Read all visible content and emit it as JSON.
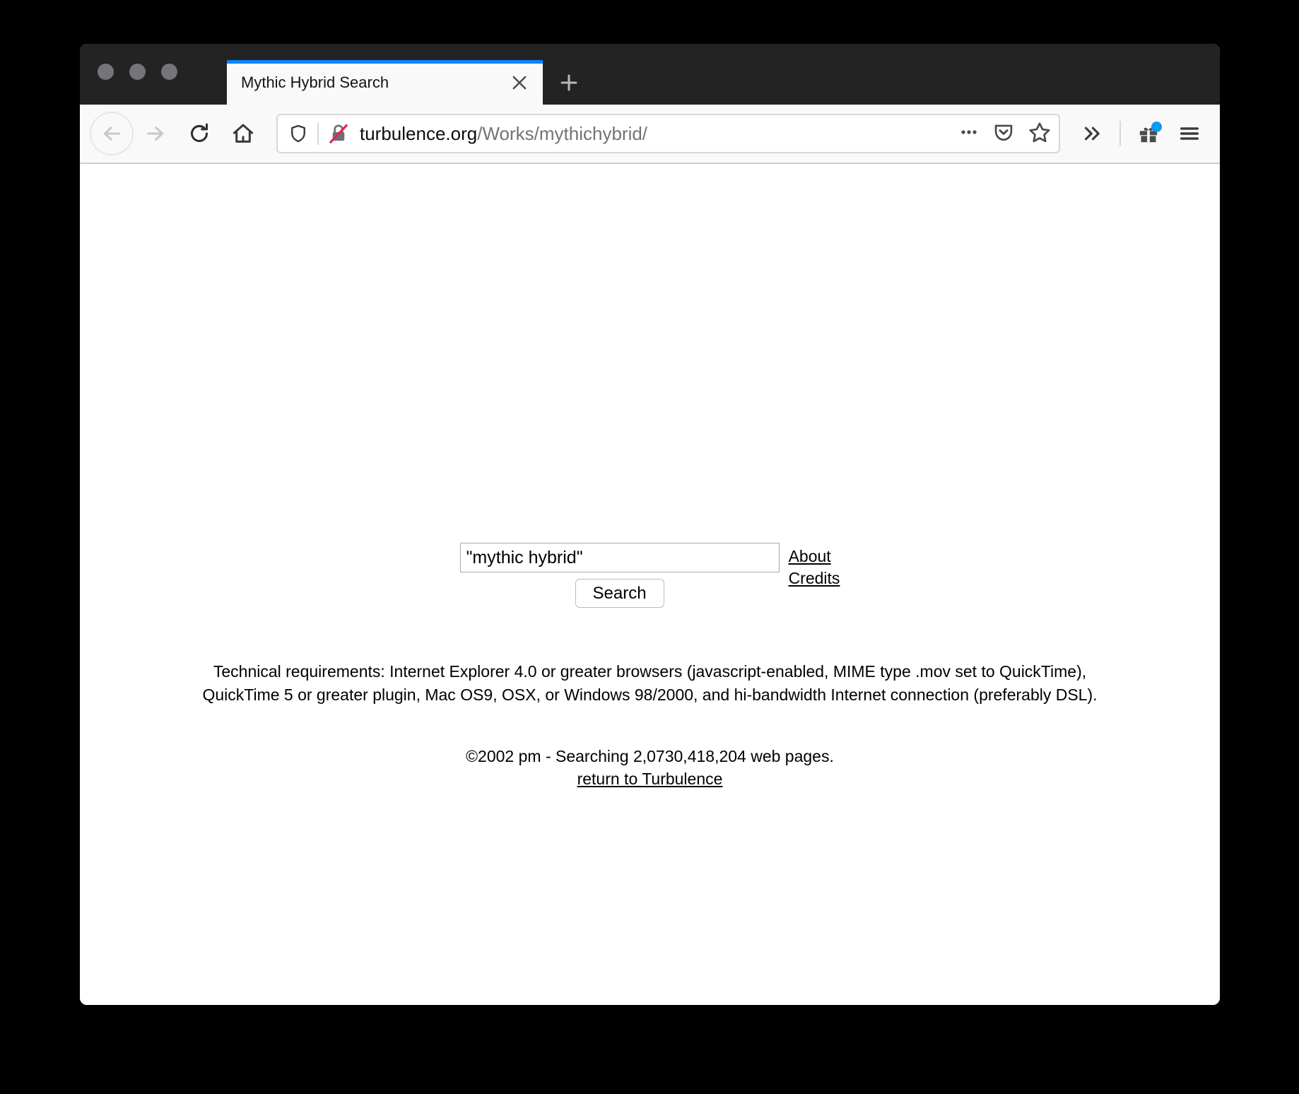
{
  "window": {
    "traffic_lights": [
      "close",
      "minimize",
      "maximize"
    ]
  },
  "tabs": [
    {
      "title": "Mythic Hybrid Search",
      "active": true,
      "close_label": "×"
    }
  ],
  "newtab": {
    "label": "+"
  },
  "toolbar": {
    "back_label": "Back",
    "forward_label": "Forward",
    "reload_label": "Reload",
    "home_label": "Home",
    "page_actions_label": "…",
    "pocket_label": "Save to Pocket",
    "bookmark_label": "Bookmark this page",
    "overflow_label": "»",
    "gift_label": "Gift",
    "menu_label": "Open menu"
  },
  "urlbar": {
    "host": "turbulence.org",
    "path": "/Works/mythichybrid/",
    "full_url": "turbulence.org/Works/mythichybrid/",
    "security": "insecure",
    "shield_label": "Enhanced Tracking Protection",
    "lock_label": "Connection is not secure"
  },
  "page": {
    "search": {
      "value": "\"mythic hybrid\"",
      "placeholder": "",
      "button_label": "Search"
    },
    "side_links": [
      {
        "label": "About"
      },
      {
        "label": "Credits"
      }
    ],
    "tech_requirements": [
      "Technical requirements: Internet Explorer 4.0 or greater browsers (javascript-enabled, MIME type .mov set to QuickTime),",
      "QuickTime 5 or greater plugin, Mac OS9, OSX, or Windows 98/2000, and hi-bandwidth Internet connection (preferably DSL)."
    ],
    "footer": {
      "copyright": "©2002 pm - Searching 2,0730,418,204 web pages.",
      "return_link": "return to Turbulence"
    }
  },
  "colors": {
    "accent_tab": "#0a84ff",
    "titlebar": "#232323",
    "toolbar": "#f9f9fa",
    "badge": "#0a9bef",
    "desktop": "#000000"
  }
}
